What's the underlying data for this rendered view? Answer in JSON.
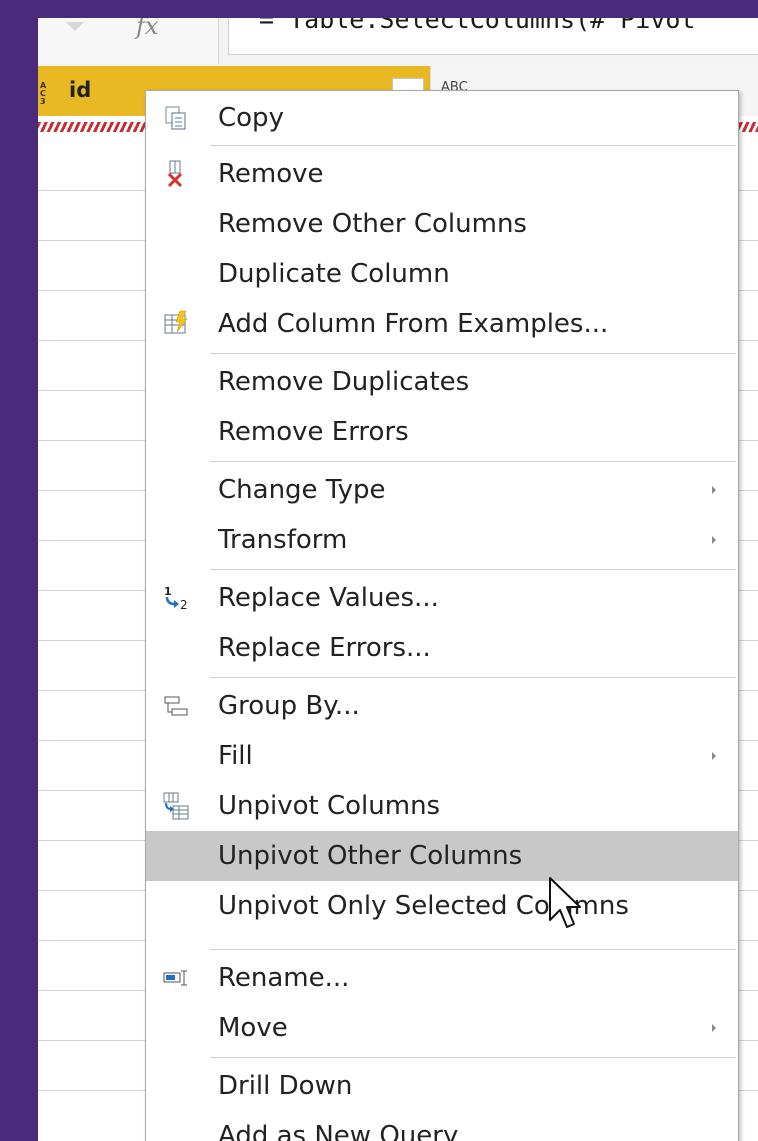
{
  "formula_bar": {
    "fx_label": "fx",
    "formula_text": "= Table.SelectColumns(#\"Pivot"
  },
  "grid": {
    "column_title": "id",
    "type_icon": "ABC 123",
    "next_column_type": "ABC"
  },
  "menu": {
    "items": [
      {
        "label": "Copy",
        "icon": "copy-icon"
      },
      {
        "label": "Remove",
        "icon": "remove-icon"
      },
      {
        "label": "Remove Other Columns"
      },
      {
        "label": "Duplicate Column"
      },
      {
        "label": "Add Column From Examples...",
        "icon": "add-column-from-examples-icon"
      },
      {
        "label": "Remove Duplicates"
      },
      {
        "label": "Remove Errors"
      },
      {
        "label": "Change Type",
        "submenu": true
      },
      {
        "label": "Transform",
        "submenu": true
      },
      {
        "label": "Replace Values...",
        "icon": "replace-values-icon"
      },
      {
        "label": "Replace Errors..."
      },
      {
        "label": "Group By...",
        "icon": "group-by-icon"
      },
      {
        "label": "Fill",
        "submenu": true
      },
      {
        "label": "Unpivot Columns",
        "icon": "unpivot-columns-icon"
      },
      {
        "label": "Unpivot Other Columns",
        "highlighted": true
      },
      {
        "label": "Unpivot Only Selected Columns"
      },
      {
        "label": "Rename...",
        "icon": "rename-icon"
      },
      {
        "label": "Move",
        "submenu": true
      },
      {
        "label": "Drill Down"
      },
      {
        "label": "Add as New Query"
      }
    ]
  },
  "colors": {
    "background": "#4a2a7a",
    "column_header": "#e8b923",
    "highlight": "#c8c8c8"
  }
}
